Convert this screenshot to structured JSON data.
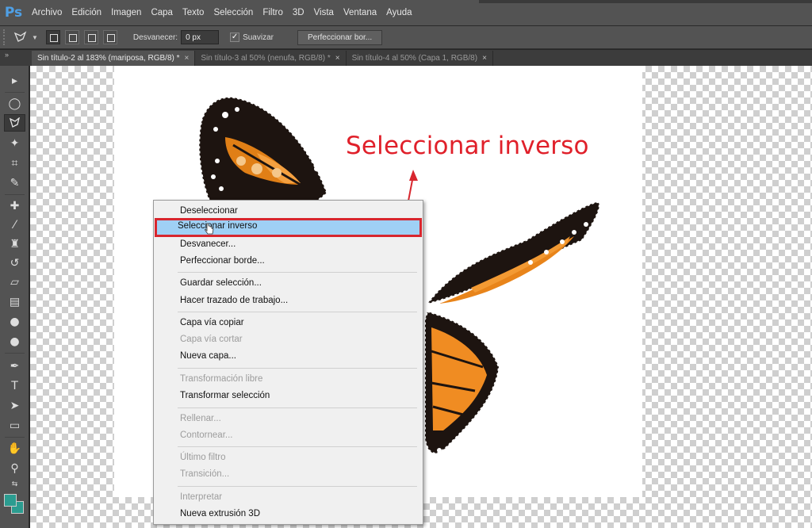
{
  "menubar": {
    "logo": "Ps",
    "items": [
      "Archivo",
      "Edición",
      "Imagen",
      "Capa",
      "Texto",
      "Selección",
      "Filtro",
      "3D",
      "Vista",
      "Ventana",
      "Ayuda"
    ]
  },
  "options": {
    "tool_icon": "polygonal-lasso-icon",
    "feather_label": "Desvanecer:",
    "feather_value": "0 px",
    "antialias_label": "Suavizar",
    "antialias_checked": true,
    "refine_button": "Perfeccionar bor..."
  },
  "tabs": [
    {
      "label": "Sin título-2 al 183% (mariposa, RGB/8) *",
      "active": true
    },
    {
      "label": "Sin título-3 al 50% (nenufa, RGB/8) *",
      "active": false
    },
    {
      "label": "Sin título-4 al 50% (Capa 1, RGB/8)",
      "active": false
    }
  ],
  "annotation": {
    "text": "Seleccionar inverso",
    "color": "#e0202a"
  },
  "context_menu": {
    "items": [
      {
        "label": "Deseleccionar",
        "enabled": true
      },
      {
        "label": "Seleccionar inverso",
        "enabled": true,
        "highlighted": true
      },
      {
        "label": "Desvanecer...",
        "enabled": true
      },
      {
        "label": "Perfeccionar borde...",
        "enabled": true
      },
      {
        "label": "Guardar selección...",
        "enabled": true
      },
      {
        "label": "Hacer trazado de trabajo...",
        "enabled": true
      },
      {
        "label": "Capa vía copiar",
        "enabled": true
      },
      {
        "label": "Capa vía cortar",
        "enabled": false
      },
      {
        "label": "Nueva capa...",
        "enabled": true
      },
      {
        "label": "Transformación libre",
        "enabled": false
      },
      {
        "label": "Transformar selección",
        "enabled": true
      },
      {
        "label": "Rellenar...",
        "enabled": false
      },
      {
        "label": "Contornear...",
        "enabled": false
      },
      {
        "label": "Último filtro",
        "enabled": false
      },
      {
        "label": "Transición...",
        "enabled": false
      },
      {
        "label": "Interpretar",
        "enabled": false
      },
      {
        "label": "Nueva extrusión 3D",
        "enabled": true
      }
    ]
  },
  "colors": {
    "foreground": "#2b9c90",
    "background": "#2b9c90",
    "highlight_bg": "#9fd0f5",
    "highlight_border": "#d8262e"
  }
}
